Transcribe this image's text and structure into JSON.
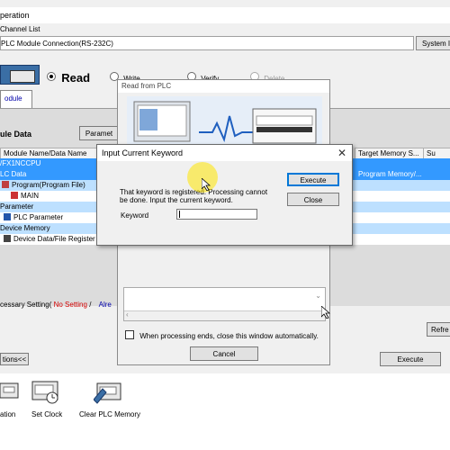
{
  "window": {
    "title": "peration",
    "channel_list_label": "Channel List",
    "connection": "PLC Module Connection(RS-232C)",
    "system_image_label": "System I"
  },
  "mode": {
    "read_label": "Read",
    "write_label": "Write",
    "verify_label": "Verify",
    "delete_label": "Delete",
    "selected": "Read"
  },
  "tabs": {
    "module_label": "odule"
  },
  "module_data": {
    "section_label": "ule Data",
    "param_button": "Paramet",
    "columns": [
      "Module Name/Data Name",
      "Target Memory S...",
      "Su"
    ],
    "rows": [
      {
        "label": "/FX1NCCPU",
        "style": "blue"
      },
      {
        "label": "LC Data",
        "style": "blue",
        "target": "Program Memory/..."
      },
      {
        "label": "Program(Program File)",
        "style": "light"
      },
      {
        "label": "MAIN",
        "style": "white"
      },
      {
        "label": "Parameter",
        "style": "light"
      },
      {
        "label": "PLC Parameter",
        "style": "white"
      },
      {
        "label": "Device Memory",
        "style": "light"
      },
      {
        "label": "Device Data/File Register",
        "style": "white"
      }
    ]
  },
  "necessary_setting": {
    "label": "cessary Setting(",
    "value": "No Setting",
    "separator": "/",
    "already": "Alre"
  },
  "buttons": {
    "options": "tions<<",
    "execute": "Execute",
    "refresh": "Refre"
  },
  "read_from_plc": {
    "title": "Read from PLC",
    "close_checkbox_label": "When processing ends, close this window automatically.",
    "cancel": "Cancel"
  },
  "keyword_dialog": {
    "title": "Input Current Keyword",
    "message_line1": "That keyword is registered. Processing cannot",
    "message_line2": "be done. Input the current keyword.",
    "keyword_label": "Keyword",
    "keyword_value": "",
    "execute": "Execute",
    "close": "Close"
  },
  "bottom_toolbar": {
    "items": [
      "ation",
      "Set Clock",
      "Clear PLC Memory"
    ]
  },
  "colors": {
    "selection_blue": "#3399ff",
    "light_blue": "#bde0ff",
    "no_setting_red": "#d40000",
    "link_blue": "#0000aa"
  }
}
